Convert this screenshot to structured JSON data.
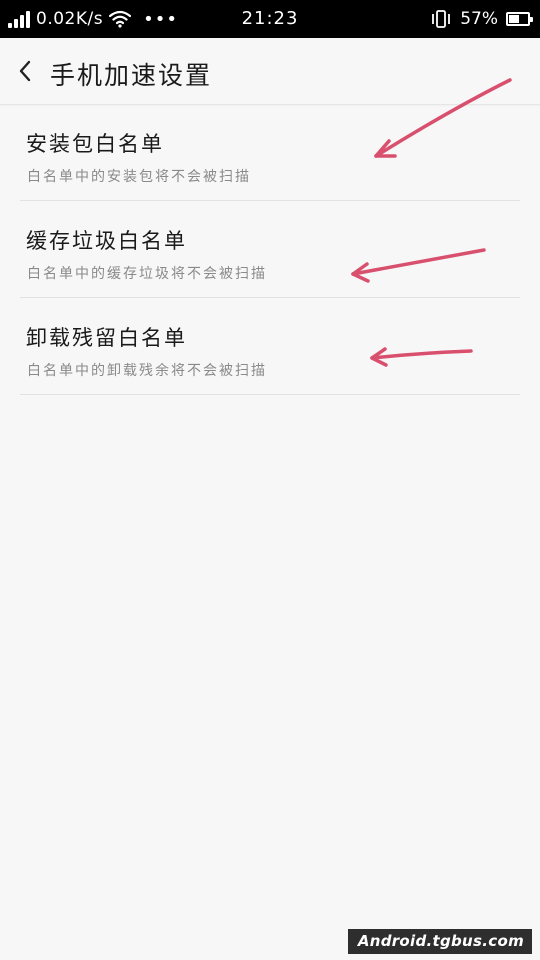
{
  "status_bar": {
    "net_speed": "0.02K/s",
    "dots": "•••",
    "time": "21:23",
    "battery_percent": "57%",
    "battery_level": 0.57,
    "icons": [
      "signal-icon",
      "wifi-icon",
      "vibrate-icon",
      "battery-icon"
    ]
  },
  "header": {
    "title": "手机加速设置",
    "back_icon": "chevron-left-icon"
  },
  "list": {
    "items": [
      {
        "title": "安装包白名单",
        "subtitle": "白名单中的安装包将不会被扫描"
      },
      {
        "title": "缓存垃圾白名单",
        "subtitle": "白名单中的缓存垃圾将不会被扫描"
      },
      {
        "title": "卸载残留白名单",
        "subtitle": "白名单中的卸载残余将不会被扫描"
      }
    ]
  },
  "annotations": {
    "arrow_color": "#d9506e"
  },
  "watermark": "Android.tgbus.com"
}
